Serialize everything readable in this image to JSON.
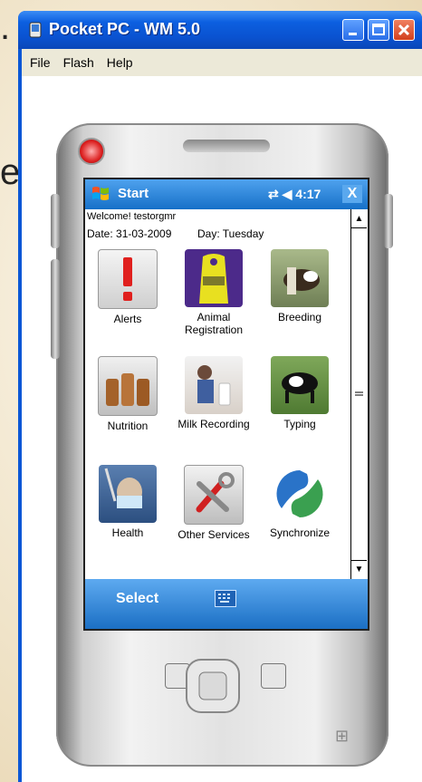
{
  "slide": {
    "partial_text_top": ".",
    "partial_text_mid": "e"
  },
  "window": {
    "title": "Pocket PC - WM 5.0",
    "menu": [
      "File",
      "Flash",
      "Help"
    ]
  },
  "device": {
    "top_bar": {
      "start_label": "Start",
      "status": "⇄ ◀ 4:17",
      "close_label": "X"
    },
    "welcome": "Welcome!  testorgmr",
    "date": "Date: 31-03-2009",
    "day": "Day: Tuesday",
    "icons": [
      {
        "label": "Alerts",
        "icon": "alert-icon"
      },
      {
        "label": "Animal Registration",
        "icon": "ear-tag-icon"
      },
      {
        "label": "Breeding",
        "icon": "breeding-icon"
      },
      {
        "label": "Nutrition",
        "icon": "nutrition-icon"
      },
      {
        "label": "Milk Recording",
        "icon": "milk-recording-icon"
      },
      {
        "label": "Typing",
        "icon": "cow-icon"
      },
      {
        "label": "Health",
        "icon": "health-icon"
      },
      {
        "label": "Other Services",
        "icon": "tools-icon"
      },
      {
        "label": "Synchronize",
        "icon": "sync-icon"
      }
    ],
    "bottom_bar": {
      "select_label": "Select"
    }
  }
}
